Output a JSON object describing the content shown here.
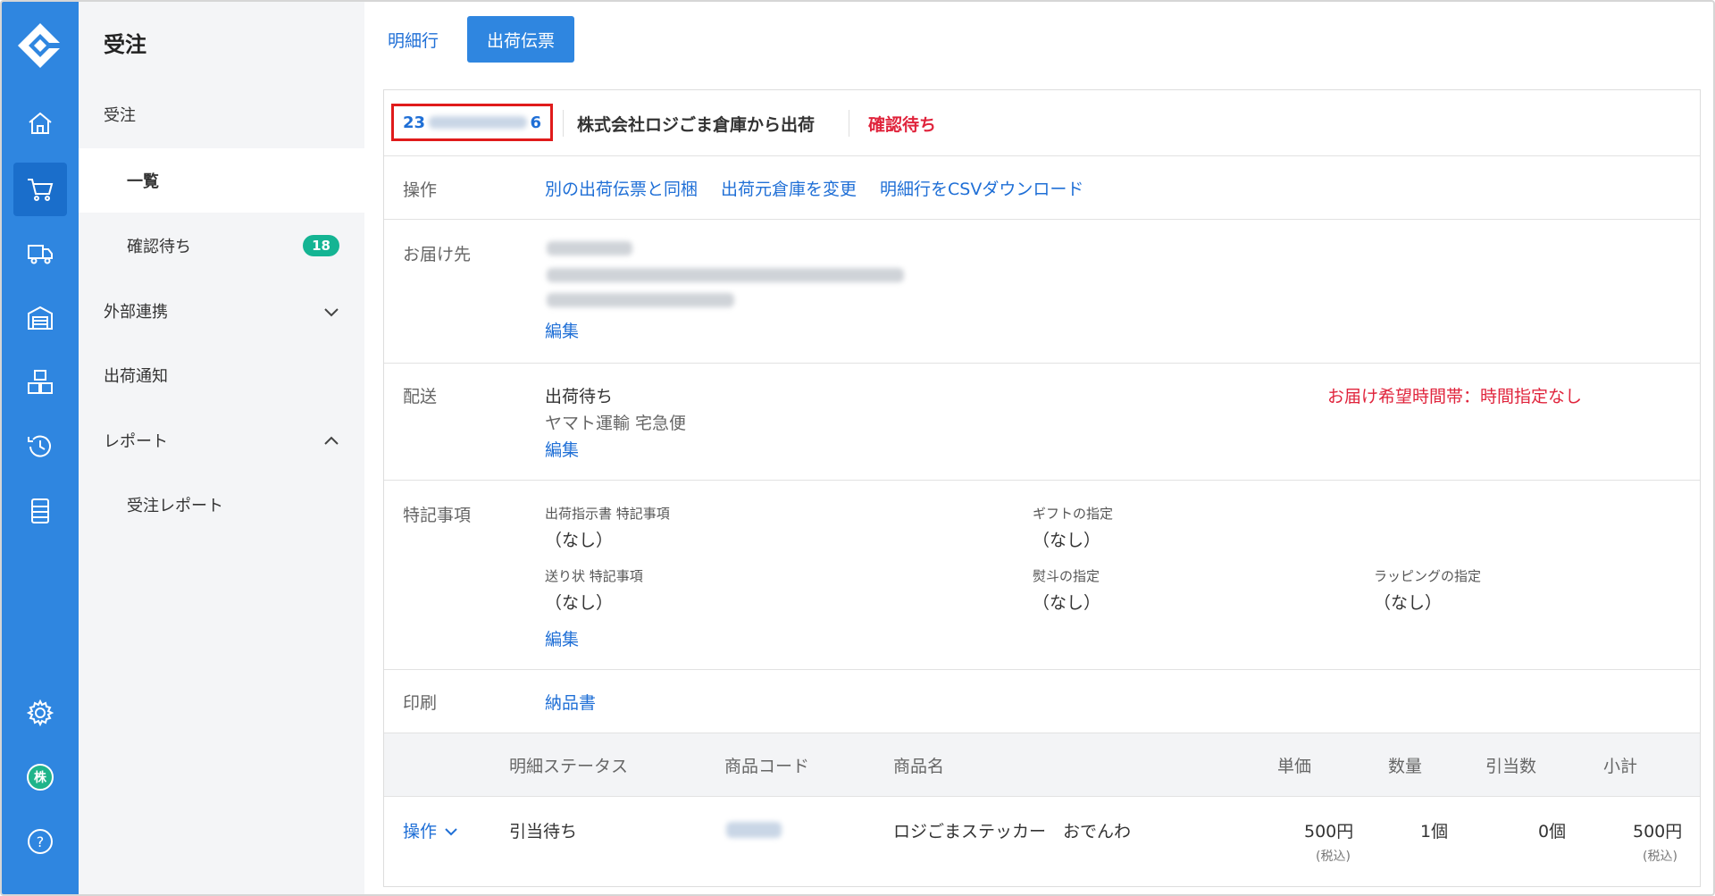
{
  "rail": {
    "icons": [
      "logo-icon",
      "home-icon",
      "cart-icon",
      "truck-icon",
      "warehouse-icon",
      "boxes-icon",
      "history-icon",
      "list-icon",
      "gear-icon",
      "avatar",
      "help-icon"
    ],
    "avatar_text": "株",
    "help_text": "?"
  },
  "menu": {
    "title": "受注",
    "items": [
      {
        "label": "受注"
      },
      {
        "label": "一覧"
      },
      {
        "label": "確認待ち",
        "badge": "18"
      },
      {
        "label": "外部連携"
      },
      {
        "label": "出荷通知"
      },
      {
        "label": "レポート"
      },
      {
        "label": "受注レポート"
      }
    ]
  },
  "tabs": [
    {
      "label": "明細行"
    },
    {
      "label": "出荷伝票"
    }
  ],
  "header": {
    "order_prefix": "23",
    "order_suffix": "6",
    "warehouse": "株式会社ロジごま倉庫から出荷",
    "status": "確認待ち"
  },
  "operations": {
    "label": "操作",
    "links": [
      "別の出荷伝票と同梱",
      "出荷元倉庫を変更",
      "明細行をCSVダウンロード"
    ]
  },
  "destination": {
    "label": "お届け先",
    "edit": "編集"
  },
  "delivery": {
    "label": "配送",
    "status": "出荷待ち",
    "carrier": "ヤマト運輸 宅急便",
    "edit": "編集",
    "time_note": "お届け希望時間帯：時間指定なし"
  },
  "notes": {
    "label": "特記事項",
    "fields": [
      {
        "label": "出荷指示書 特記事項",
        "value": "（なし）"
      },
      {
        "label": "ギフトの指定",
        "value": "（なし）"
      },
      {
        "label": "送り状 特記事項",
        "value": "（なし）"
      },
      {
        "label": "熨斗の指定",
        "value": "（なし）"
      },
      {
        "label": "ラッピングの指定",
        "value": "（なし）"
      }
    ],
    "edit": "編集"
  },
  "print": {
    "label": "印刷",
    "link": "納品書"
  },
  "table": {
    "headers": [
      "明細ステータス",
      "商品コード",
      "商品名",
      "単価",
      "数量",
      "引当数",
      "小計"
    ],
    "rows": [
      {
        "action": "操作",
        "status": "引当待ち",
        "name": "ロジごまステッカー　おでんわ",
        "unit_price": "500円",
        "unit_tax": "(税込)",
        "qty": "1個",
        "allocated": "0個",
        "subtotal": "500円",
        "subtotal_tax": "(税込)"
      }
    ]
  },
  "colors": {
    "rail": "#2f86e0",
    "rail_active": "#1a6ecb",
    "link": "#1f6fd6",
    "alert": "#e0243c",
    "badge": "#14b493",
    "highlight_box": "#e01b1b"
  }
}
